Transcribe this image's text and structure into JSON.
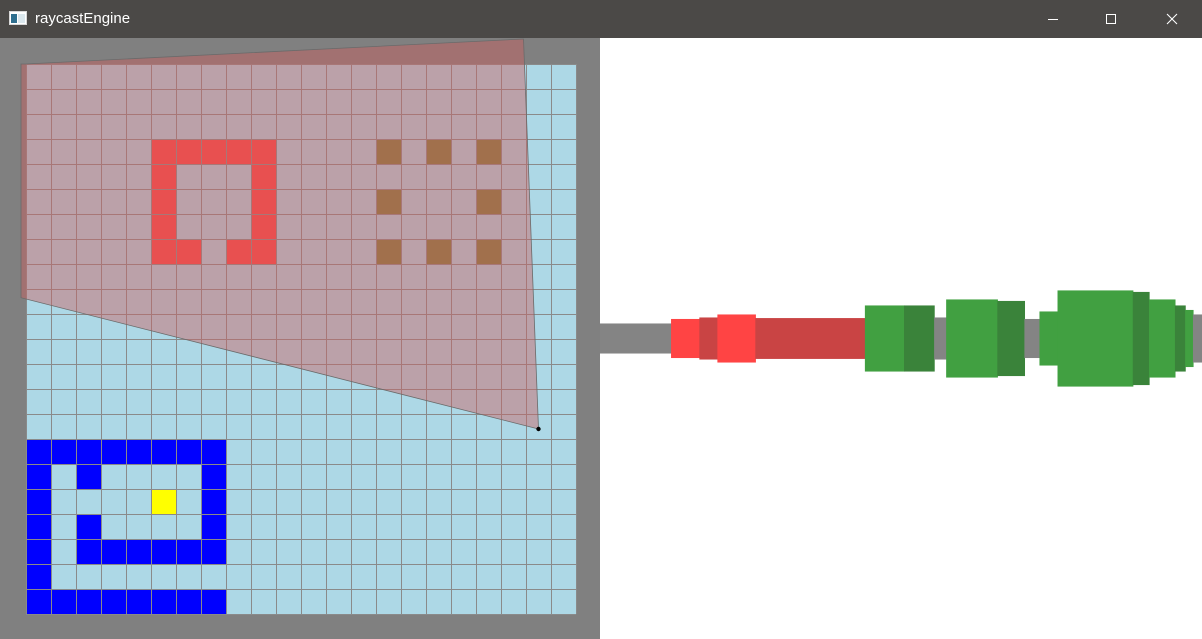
{
  "window": {
    "title": "raycastEngine",
    "app_icon": "window-app-icon",
    "controls": {
      "minimize_icon": "minimize-icon",
      "maximize_icon": "maximize-icon",
      "close_icon": "close-icon"
    }
  },
  "colors": {
    "titlebar": "#4b4947",
    "border": "#808080",
    "floor_tile": "#add8e6",
    "grid_line": "#8a8a8a",
    "wall_red": "#ff4444",
    "wall_olive": "#7f7f3c",
    "wall_blue": "#0000ff",
    "goal_yellow": "#ffff00",
    "fov_overlay": "rgba(205,95,95,0.45)",
    "render_bg": "#ffffff",
    "render_gray": "#848484",
    "render_red": "#ff4444",
    "render_red_dark": "#c94444",
    "render_green": "#41a041",
    "render_green_dark": "#3a833a"
  },
  "map": {
    "cols": 22,
    "rows": 22,
    "grid": [
      "......................",
      "......................",
      "......................",
      "......................",
      "......................",
      "......................",
      "......................",
      "......................",
      "......................",
      "......................",
      "......................",
      "......................",
      "......................",
      "......................",
      "......................",
      "......................",
      "......................",
      "......................",
      "......................",
      "......................",
      "......................",
      "......................"
    ],
    "walls": [
      {
        "kind": "red",
        "cells": [
          [
            5,
            3
          ],
          [
            6,
            3
          ],
          [
            7,
            3
          ],
          [
            8,
            3
          ],
          [
            9,
            3
          ],
          [
            5,
            4
          ],
          [
            9,
            4
          ],
          [
            5,
            5
          ],
          [
            9,
            5
          ],
          [
            5,
            6
          ],
          [
            9,
            6
          ],
          [
            5,
            7
          ],
          [
            6,
            7
          ],
          [
            8,
            7
          ],
          [
            9,
            7
          ]
        ]
      },
      {
        "kind": "olive",
        "cells": [
          [
            14,
            3
          ],
          [
            16,
            3
          ],
          [
            18,
            3
          ],
          [
            14,
            5
          ],
          [
            18,
            5
          ],
          [
            14,
            7
          ],
          [
            16,
            7
          ],
          [
            18,
            7
          ]
        ]
      },
      {
        "kind": "blue",
        "cells": [
          [
            0,
            15
          ],
          [
            1,
            15
          ],
          [
            2,
            15
          ],
          [
            3,
            15
          ],
          [
            4,
            15
          ],
          [
            5,
            15
          ],
          [
            6,
            15
          ],
          [
            7,
            15
          ],
          [
            0,
            16
          ],
          [
            2,
            16
          ],
          [
            7,
            16
          ],
          [
            0,
            17
          ],
          [
            7,
            17
          ],
          [
            0,
            18
          ],
          [
            2,
            18
          ],
          [
            7,
            18
          ],
          [
            0,
            19
          ],
          [
            2,
            19
          ],
          [
            3,
            19
          ],
          [
            4,
            19
          ],
          [
            5,
            19
          ],
          [
            6,
            19
          ],
          [
            7,
            19
          ],
          [
            0,
            20
          ],
          [
            0,
            21
          ],
          [
            1,
            21
          ],
          [
            2,
            21
          ],
          [
            3,
            21
          ],
          [
            4,
            21
          ],
          [
            5,
            21
          ],
          [
            6,
            21
          ],
          [
            7,
            21
          ]
        ]
      },
      {
        "kind": "goal",
        "cells": [
          [
            5,
            17
          ]
        ]
      }
    ],
    "player": {
      "col": 20.5,
      "row": 14.6
    },
    "fov_rays": [
      [
        -0.2,
        0.0
      ],
      [
        0.0,
        0.0
      ],
      [
        -0.2,
        9.35
      ],
      [
        19.9,
        -1.0
      ]
    ]
  },
  "render": {
    "horizon": 0.5,
    "columns": [
      {
        "from": 0.0,
        "to": 0.118,
        "h": 0.05,
        "shade": "gray"
      },
      {
        "from": 0.118,
        "to": 0.165,
        "h": 0.065,
        "shade": "red"
      },
      {
        "from": 0.165,
        "to": 0.195,
        "h": 0.07,
        "shade": "red_dark"
      },
      {
        "from": 0.195,
        "to": 0.258,
        "h": 0.08,
        "shade": "red"
      },
      {
        "from": 0.258,
        "to": 0.44,
        "h": 0.068,
        "shade": "red_dark"
      },
      {
        "from": 0.44,
        "to": 0.505,
        "h": 0.11,
        "shade": "green"
      },
      {
        "from": 0.505,
        "to": 0.555,
        "h": 0.11,
        "shade": "green_dark"
      },
      {
        "from": 0.555,
        "to": 0.575,
        "h": 0.07,
        "shade": "gray"
      },
      {
        "from": 0.575,
        "to": 0.66,
        "h": 0.13,
        "shade": "green"
      },
      {
        "from": 0.66,
        "to": 0.705,
        "h": 0.125,
        "shade": "green_dark"
      },
      {
        "from": 0.705,
        "to": 0.73,
        "h": 0.065,
        "shade": "gray"
      },
      {
        "from": 0.73,
        "to": 0.76,
        "h": 0.09,
        "shade": "green"
      },
      {
        "from": 0.76,
        "to": 0.885,
        "h": 0.16,
        "shade": "green"
      },
      {
        "from": 0.885,
        "to": 0.912,
        "h": 0.155,
        "shade": "green_dark"
      },
      {
        "from": 0.912,
        "to": 0.955,
        "h": 0.13,
        "shade": "green"
      },
      {
        "from": 0.955,
        "to": 0.972,
        "h": 0.11,
        "shade": "green_dark"
      },
      {
        "from": 0.972,
        "to": 0.985,
        "h": 0.095,
        "shade": "green"
      },
      {
        "from": 0.985,
        "to": 1.0,
        "h": 0.08,
        "shade": "gray"
      }
    ]
  }
}
